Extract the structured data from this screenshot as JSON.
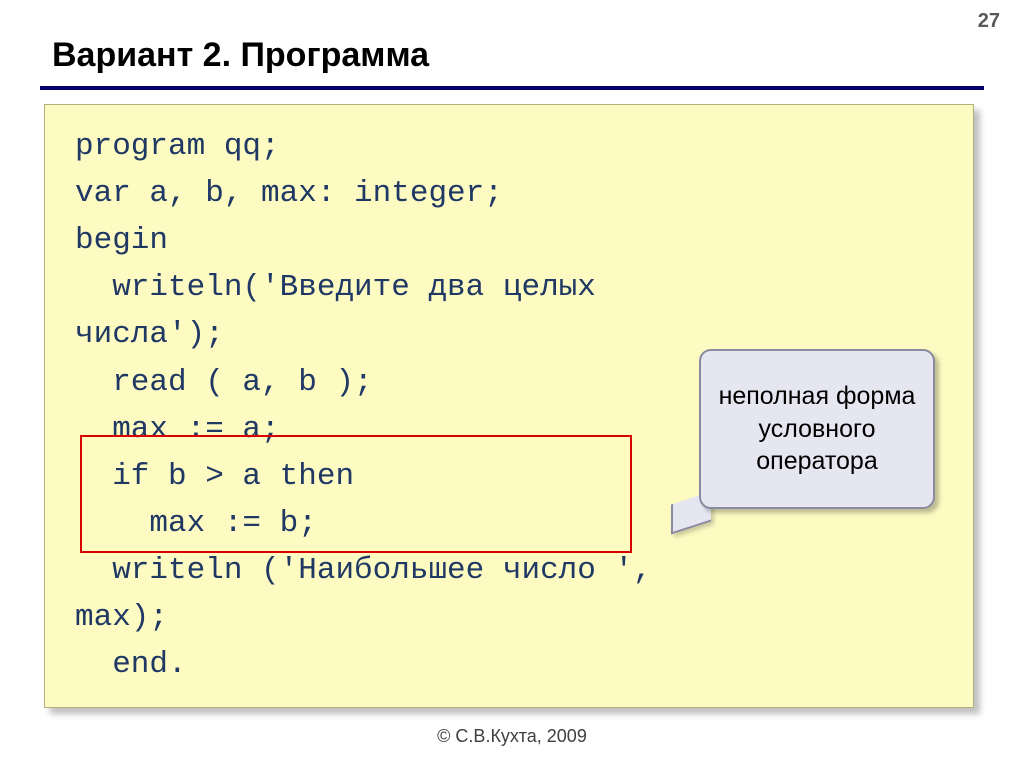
{
  "page_number": "27",
  "title": "Вариант 2. Программа",
  "code": "program qq;\nvar a, b, max: integer;\nbegin\n  writeln('Введите два целых\nчисла');\n  read ( a, b );\n  max := a;\n  if b > a then\n    max := b;\n  writeln ('Наибольшее число ',\nmax);\n  end.",
  "callout_text": "неполная форма условного оператора",
  "footer": "© С.В.Кухта, 2009"
}
